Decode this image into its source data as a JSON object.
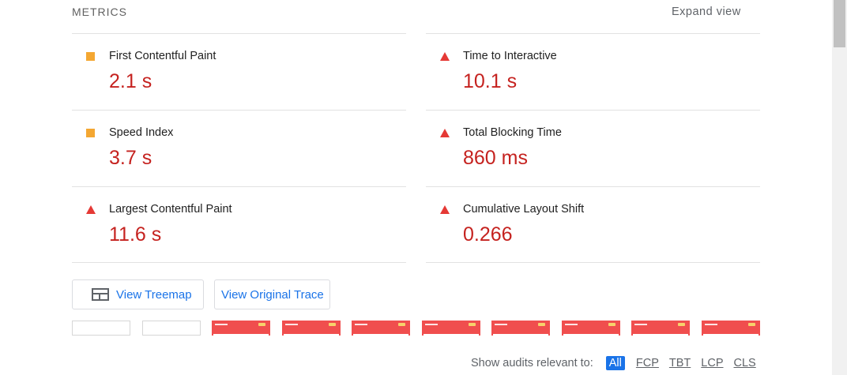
{
  "header": {
    "title": "METRICS",
    "expand_label": "Expand view"
  },
  "metrics": [
    {
      "label": "First Contentful Paint",
      "value": "2.1 s",
      "rating": "average",
      "icon": "orange-square-icon"
    },
    {
      "label": "Time to Interactive",
      "value": "10.1 s",
      "rating": "fail",
      "icon": "red-triangle-icon"
    },
    {
      "label": "Speed Index",
      "value": "3.7 s",
      "rating": "average",
      "icon": "orange-square-icon"
    },
    {
      "label": "Total Blocking Time",
      "value": "860 ms",
      "rating": "fail",
      "icon": "red-triangle-icon"
    },
    {
      "label": "Largest Contentful Paint",
      "value": "11.6 s",
      "rating": "fail",
      "icon": "red-triangle-icon"
    },
    {
      "label": "Cumulative Layout Shift",
      "value": "0.266",
      "rating": "fail",
      "icon": "red-triangle-icon"
    }
  ],
  "buttons": {
    "treemap": "View Treemap",
    "trace": "View Original Trace"
  },
  "filmstrip": {
    "frames": [
      "blank",
      "blank",
      "loaded",
      "loaded",
      "loaded",
      "loaded",
      "loaded",
      "loaded",
      "loaded",
      "loaded"
    ]
  },
  "audit_filter": {
    "label": "Show audits relevant to:",
    "options": [
      "All",
      "FCP",
      "TBT",
      "LCP",
      "CLS"
    ],
    "selected": "All"
  },
  "colors": {
    "average": "#f4a732",
    "fail": "#e53935",
    "value": "#c5221f",
    "accent": "#1a73e8"
  }
}
